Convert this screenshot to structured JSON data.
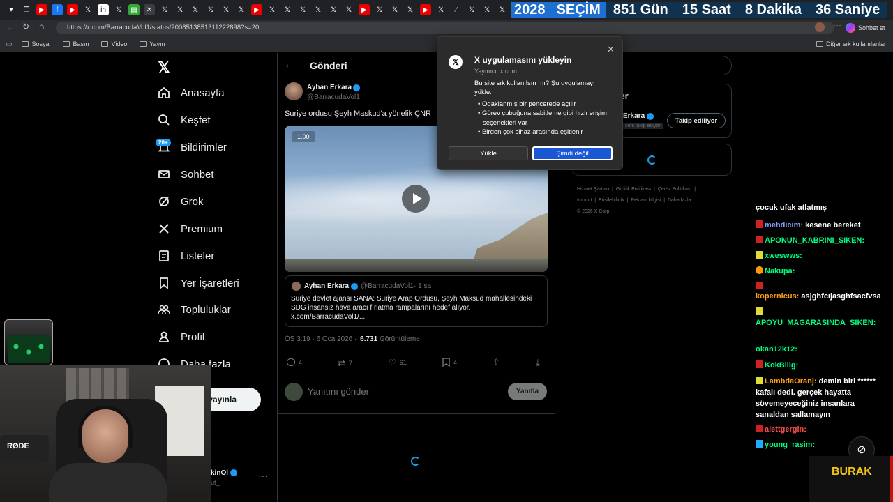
{
  "browser": {
    "url": "https://x.com/BarracudaVol1/status/2008513851311222898?s=20",
    "bookmarks": [
      "Sosyal",
      "Basın",
      "Video",
      "Yayın"
    ],
    "other_bookmarks": "Diğer sık kullanılanlar",
    "chat_button": "Sohbet et"
  },
  "countdown": {
    "year": "2028",
    "label": "SEÇİM",
    "days": "851 Gün",
    "hours": "15 Saat",
    "minutes": "8 Dakika",
    "seconds": "36 Saniye"
  },
  "sidebar": {
    "items": [
      {
        "label": "Anasayfa"
      },
      {
        "label": "Keşfet"
      },
      {
        "label": "Bildirimler",
        "badge": "20+"
      },
      {
        "label": "Sohbet"
      },
      {
        "label": "Grok"
      },
      {
        "label": "Premium"
      },
      {
        "label": "Listeler"
      },
      {
        "label": "Yer İşaretleri"
      },
      {
        "label": "Topluluklar"
      },
      {
        "label": "Profil"
      },
      {
        "label": "Daha fazla"
      }
    ],
    "post_button": "yayınla",
    "account_name": "kinOl",
    "account_handle": "ut_"
  },
  "header": {
    "title": "Gönderi"
  },
  "tweet": {
    "author": "Ayhan Erkara",
    "handle": "@BarracudaVol1",
    "text": "Suriye ordusu Şeyh Maskud'a yönelik ÇNR",
    "video_rate": "1.00",
    "quote": {
      "author": "Ayhan Erkara",
      "handle": "@BarracudaVol1",
      "time": "· 1 sa",
      "text": "Suriye devlet ajansı SANA: Suriye Arap Ordusu, Şeyh Maksud mahallesindeki SDG insansız hava aracı fırlatma rampalarını hedef alıyor. x.com/BarracudaVol1/..."
    },
    "meta_time": "ÖS 3:19 · 6 Oca 2026 ·",
    "views_count": "6.731",
    "views_label": "Görüntüleme",
    "replies": "4",
    "retweets": "7",
    "likes": "61",
    "bookmarks": "4",
    "reply_placeholder": "Yanıtını gönder",
    "reply_button": "Yanıtla"
  },
  "right": {
    "section_title": "Kişiler",
    "person_name": "Erkara",
    "person_note": "seni takip ediyor",
    "follow_button": "Takip ediliyor",
    "footer_links": [
      "Hizmet Şartları",
      "Gizlilik Politikası",
      "Çerez Politikası",
      "Imprint",
      "Erişilebilirlik",
      "Reklam bilgisi",
      "Daha fazla ..."
    ],
    "copyright": "© 2026 X Corp."
  },
  "popup": {
    "title": "X uygulamasını yükleyin",
    "publisher": "Yayımcı: x.com",
    "question": "Bu site sık kullanılsın mı? Şu uygulamayı yükle:",
    "bullets": [
      "Odaklanmış bir pencerede açılır",
      "Görev çubuğuna sabitleme gibi hızlı erişim seçenekleri var",
      "Birden çok cihaz arasında eşitlenir"
    ],
    "install_button": "Yükle",
    "later_button": "Şimdi değil"
  },
  "chat": {
    "messages": [
      {
        "user": "",
        "text": "çocuk ufak atlatmış",
        "color": "#ffffff"
      },
      {
        "user": "mehdicim:",
        "text": "kesene bereket",
        "color": "#8a9bff"
      },
      {
        "user": "APONUN_KABRINI_SIKEN:",
        "text": "",
        "color": "#00ff7f"
      },
      {
        "user": "xweswws:",
        "text": "",
        "color": "#00ff7f"
      },
      {
        "user": "Nakupa:",
        "text": "",
        "color": "#00ff7f"
      },
      {
        "user": "kopernicus:",
        "text": "asjghfcıjasghfsacfvsa",
        "color": "#ff9f1a"
      },
      {
        "user": "APOYU_MAGARASINDA_SIKEN:",
        "text": "",
        "color": "#00ff7f"
      },
      {
        "user": "okan12k12:",
        "text": "",
        "color": "#00ff7f"
      },
      {
        "user": "KokBilig:",
        "text": "",
        "color": "#00ff7f"
      },
      {
        "user": "LambdaOranj:",
        "text": "demin biri ****** kafalı dedi. gerçek hayatta sövemeyeceğiniz insanlara sanaldan sallamayın",
        "color": "#ff9f1a"
      },
      {
        "user": "alettgergin:",
        "text": "",
        "color": "#ff4d4d"
      },
      {
        "user": "young_rasim:",
        "text": "",
        "color": "#00ff7f"
      }
    ]
  },
  "overlay": {
    "streamer_name": "BURAK",
    "mic_brand": "RØDE"
  }
}
